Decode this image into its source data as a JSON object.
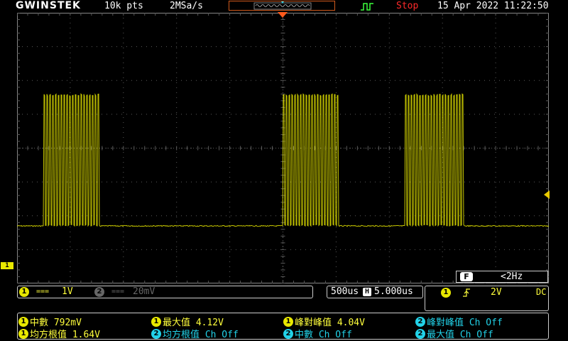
{
  "top": {
    "brand": "GWINSTEK",
    "record_length": "10k pts",
    "sample_rate": "2MSa/s",
    "run_state": "Stop",
    "datetime": "15 Apr 2022 11:22:50"
  },
  "counter": {
    "icon": "F",
    "value": "<2Hz"
  },
  "ch1": {
    "num": "1",
    "coupling_symbol": "===",
    "scale": "1V",
    "marker": "1"
  },
  "ch2": {
    "num": "2",
    "coupling_symbol": "===",
    "scale": "20mV"
  },
  "timebase": {
    "scale": "500us",
    "H_label": "H",
    "position": "5.000us"
  },
  "trigger": {
    "num": "1",
    "slope_icon": "rising-edge-icon",
    "level": "2V",
    "coupling": "DC"
  },
  "measurements": [
    {
      "ch": "1",
      "label": "中數 792mV"
    },
    {
      "ch": "1",
      "label": "最大值 4.12V"
    },
    {
      "ch": "1",
      "label": "峰對峰值 4.04V"
    },
    {
      "ch": "2",
      "label": "峰對峰值 Ch Off"
    },
    {
      "ch": "1",
      "label": "均方根值 1.64V"
    },
    {
      "ch": "2",
      "label": "均方根值 Ch Off"
    },
    {
      "ch": "2",
      "label": "中數 Ch Off"
    },
    {
      "ch": "2",
      "label": "最大值 Ch Off"
    }
  ],
  "colors": {
    "ch1": "#e8e800",
    "ch2": "#22d2e8",
    "stop": "#ff2a2a",
    "grid": "#5a5a5a"
  },
  "waveform": {
    "low_level_div": -2.3,
    "high_level_div": 1.6,
    "burst_start_div": [
      -4.5,
      0.0,
      2.3
    ],
    "burst_end_div": [
      -3.45,
      1.05,
      3.4
    ]
  }
}
